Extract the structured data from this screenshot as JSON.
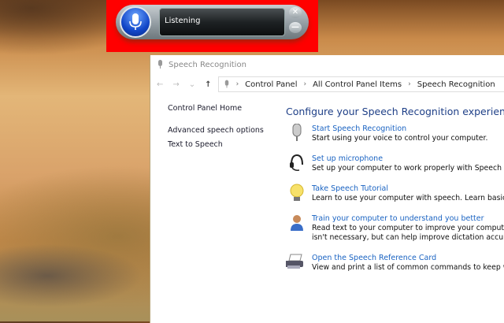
{
  "speech_widget": {
    "status": "Listening",
    "close_glyph": "✕",
    "minimize_glyph": "—"
  },
  "window": {
    "title": "Speech Recognition",
    "nav": {
      "back": "←",
      "forward": "→",
      "recent": "⌄",
      "up": "↑"
    },
    "breadcrumb": [
      "Control Panel",
      "All Control Panel Items",
      "Speech Recognition"
    ],
    "breadcrumb_separator": "›",
    "sidebar": [
      {
        "label": "Control Panel Home"
      },
      {
        "label": "Advanced speech options"
      },
      {
        "label": "Text to Speech"
      }
    ],
    "heading": "Configure your Speech Recognition experience",
    "tasks": [
      {
        "icon": "microphone-icon",
        "title": "Start Speech Recognition",
        "desc": [
          "Start using your voice to control your computer."
        ]
      },
      {
        "icon": "headset-icon",
        "title": "Set up microphone",
        "desc": [
          "Set up your computer to work properly with Speech Recogn"
        ]
      },
      {
        "icon": "lightbulb-icon",
        "title": "Take Speech Tutorial",
        "desc": [
          "Learn to use your computer with speech. Learn basic comm"
        ]
      },
      {
        "icon": "user-training-icon",
        "title": "Train your computer to understand you better",
        "desc": [
          "Read text to your computer to improve your computer's abi",
          "isn't necessary, but can help improve dictation accuracy."
        ]
      },
      {
        "icon": "printer-icon",
        "title": "Open the Speech Reference Card",
        "desc": [
          "View and print a list of common commands to keep with yo"
        ]
      }
    ]
  }
}
